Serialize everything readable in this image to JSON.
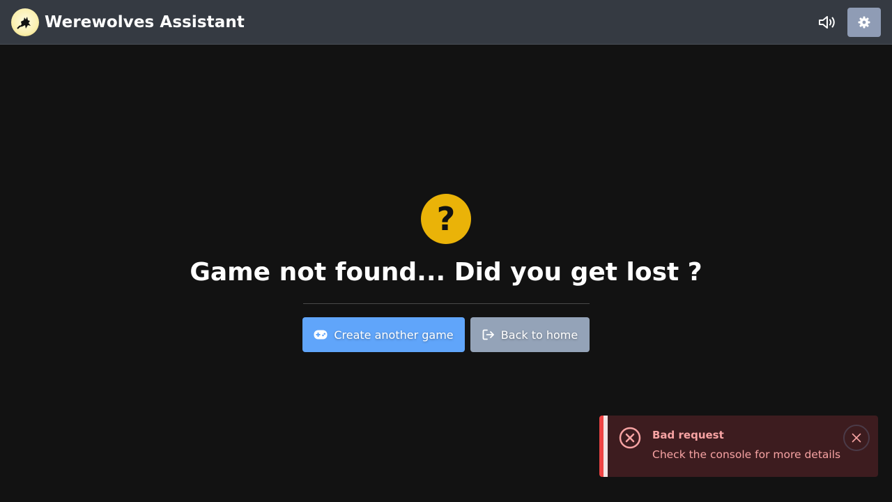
{
  "app": {
    "title": "Werewolves Assistant",
    "logo_icon": "werewolf-moon-logo",
    "sound_icon": "volume-icon",
    "settings_icon": "gear-icon"
  },
  "main": {
    "status_icon": "question-mark",
    "status_symbol": "?",
    "title": "Game not found... Did you get lost ?",
    "create_button": {
      "label": "Create another game",
      "icon": "gamepad-icon"
    },
    "home_button": {
      "label": "Back to home",
      "icon": "sign-out-icon"
    }
  },
  "toast": {
    "title": "Bad request",
    "message": "Check the console for more details",
    "icon": "error-circle-icon",
    "close_icon": "close-icon"
  },
  "colors": {
    "background": "#121212",
    "navbar": "#353a42",
    "warning": "#eab308",
    "primary": "#60a5fa",
    "secondary": "#94a3b8",
    "danger": "#ef4444",
    "toast_bg": "#3d1c1f",
    "toast_text": "#f7a3a3"
  }
}
